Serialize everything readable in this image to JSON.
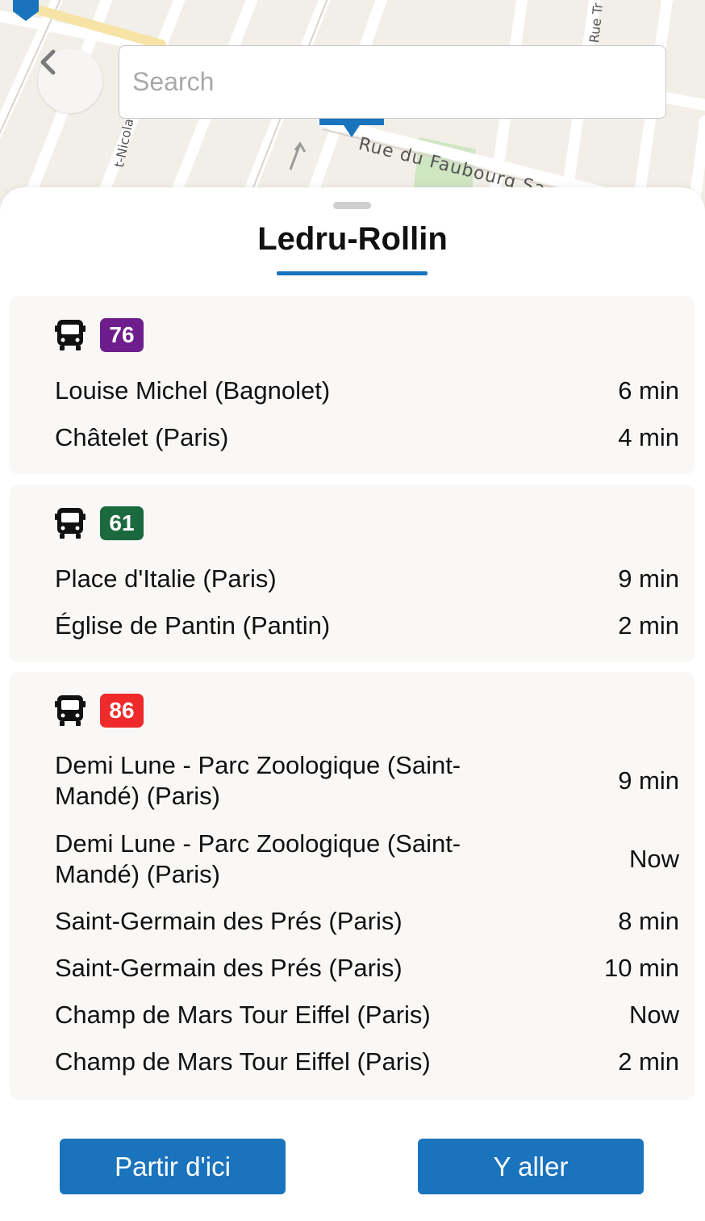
{
  "map": {
    "street_faubourg": "Rue du Faubourg Sa",
    "street_nicolas": "t-Nicolas",
    "street_tr": "Rue Tr",
    "search_placeholder": "Search"
  },
  "stop": {
    "name": "Ledru-Rollin"
  },
  "colors": {
    "accent": "#1a73bd",
    "line_76": "#6e1e8c",
    "line_61": "#1b6a3f",
    "line_86": "#ee2a2a"
  },
  "lines": [
    {
      "number": "76",
      "icon": "bus-icon",
      "departures": [
        {
          "destination": "Louise Michel (Bagnolet)",
          "time": "6 min"
        },
        {
          "destination": "Châtelet (Paris)",
          "time": "4 min"
        }
      ]
    },
    {
      "number": "61",
      "icon": "bus-icon",
      "departures": [
        {
          "destination": "Place d'Italie (Paris)",
          "time": "9 min"
        },
        {
          "destination": "Église de Pantin (Pantin)",
          "time": "2 min"
        }
      ]
    },
    {
      "number": "86",
      "icon": "bus-icon",
      "departures": [
        {
          "destination": "Demi Lune - Parc Zoologique (Saint-Mandé) (Paris)",
          "time": "9 min"
        },
        {
          "destination": "Demi Lune - Parc Zoologique (Saint-Mandé) (Paris)",
          "time": "Now"
        },
        {
          "destination": "Saint-Germain des Prés (Paris)",
          "time": "8 min"
        },
        {
          "destination": "Saint-Germain des Prés (Paris)",
          "time": "10 min"
        },
        {
          "destination": "Champ de Mars Tour Eiffel (Paris)",
          "time": "Now"
        },
        {
          "destination": "Champ de Mars Tour Eiffel (Paris)",
          "time": "2 min"
        }
      ]
    }
  ],
  "actions": {
    "depart_label": "Partir d'ici",
    "go_label": "Y aller"
  }
}
